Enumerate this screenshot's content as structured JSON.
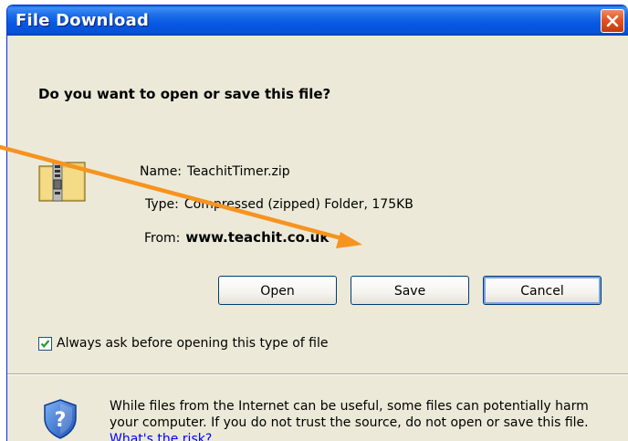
{
  "window": {
    "title": "File Download"
  },
  "prompt": {
    "question": "Do you want to open or save this file?"
  },
  "file": {
    "name_label": "Name:",
    "name_value": "TeachitTimer.zip",
    "type_label": "Type:",
    "type_value": "Compressed (zipped) Folder, 175KB",
    "from_label": "From:",
    "from_value": "www.teachit.co.uk",
    "icon": "zip-folder-icon"
  },
  "buttons": {
    "open_label": "Open",
    "save_label": "Save",
    "cancel_label": "Cancel"
  },
  "checkbox": {
    "label": "Always ask before opening this type of file",
    "checked": true
  },
  "warning": {
    "text": "While files from the Internet can be useful, some files can potentially harm your computer. If you do not trust the source, do not open or save this file.",
    "link_text": "What's the risk?",
    "icon": "security-shield-icon"
  },
  "annotation": {
    "arrow_color": "#f7931e",
    "points_to": "Save"
  },
  "colors": {
    "titlebar": "#0758e3",
    "dialog_bg": "#ece9d8",
    "close_button": "#e3541e"
  }
}
